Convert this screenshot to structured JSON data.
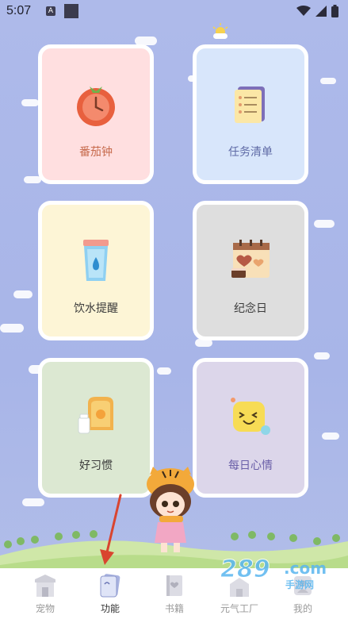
{
  "status_bar": {
    "time": "5:07",
    "indicator": "A"
  },
  "cards": [
    {
      "label": "番茄钟",
      "color": "#ffdfe0",
      "text_color": "#c76b4d",
      "icon": "tomato-clock-icon"
    },
    {
      "label": "任务清单",
      "color": "#d8e6fb",
      "text_color": "#5f6ba6",
      "icon": "task-list-icon"
    },
    {
      "label": "饮水提醒",
      "color": "#fdf5d6",
      "text_color": "#3a3a3a",
      "icon": "water-cup-icon"
    },
    {
      "label": "纪念日",
      "color": "#dedede",
      "text_color": "#3a3a3a",
      "icon": "calendar-heart-icon"
    },
    {
      "label": "好习惯",
      "color": "#dce8d2",
      "text_color": "#3a3a3a",
      "icon": "toast-milk-icon"
    },
    {
      "label": "每日心情",
      "color": "#dcd6ea",
      "text_color": "#6a5fa8",
      "icon": "happy-face-icon"
    }
  ],
  "tabs": [
    {
      "label": "宠物",
      "icon": "pet-house-icon",
      "active": false
    },
    {
      "label": "功能",
      "icon": "function-cards-icon",
      "active": true
    },
    {
      "label": "书籍",
      "icon": "book-icon",
      "active": false
    },
    {
      "label": "元气工厂",
      "icon": "factory-icon",
      "active": false
    },
    {
      "label": "我的",
      "icon": "profile-icon",
      "active": false
    }
  ],
  "watermark": {
    "brand": "289",
    "suffix": ".com",
    "site_name": "手游网"
  },
  "colors": {
    "accent_arrow": "#d9452f",
    "sky": "#a9b6ea",
    "grass": "#cfe7a8"
  }
}
